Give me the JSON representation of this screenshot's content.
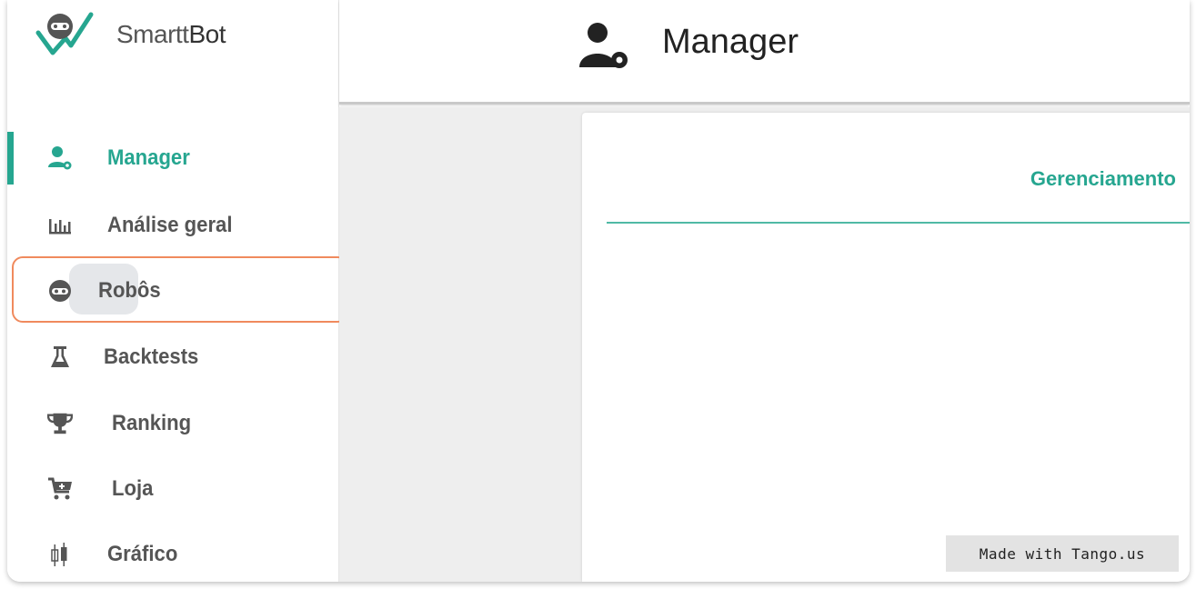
{
  "app": {
    "logo_text_light": "Smartt",
    "logo_text_bold": "Bot"
  },
  "header": {
    "title": "Manager",
    "icon": "user-gear-icon"
  },
  "sidebar": {
    "items": [
      {
        "label": "Manager",
        "icon": "user-gear-icon",
        "active": true
      },
      {
        "label": "Análise geral",
        "icon": "bar-chart-icon",
        "active": false
      },
      {
        "label": "Robôs",
        "icon": "robot-icon",
        "active": false
      },
      {
        "label": "Backtests",
        "icon": "flask-icon",
        "active": false
      },
      {
        "label": "Ranking",
        "icon": "trophy-icon",
        "active": false
      },
      {
        "label": "Loja",
        "icon": "cart-icon",
        "active": false
      },
      {
        "label": "Gráfico",
        "icon": "candlestick-icon",
        "active": false
      }
    ]
  },
  "main": {
    "card_title": "Gerenciamento"
  },
  "watermark": "Made with Tango.us",
  "colors": {
    "accent": "#26a690",
    "highlight": "#f08a5d",
    "icon": "#555555"
  }
}
